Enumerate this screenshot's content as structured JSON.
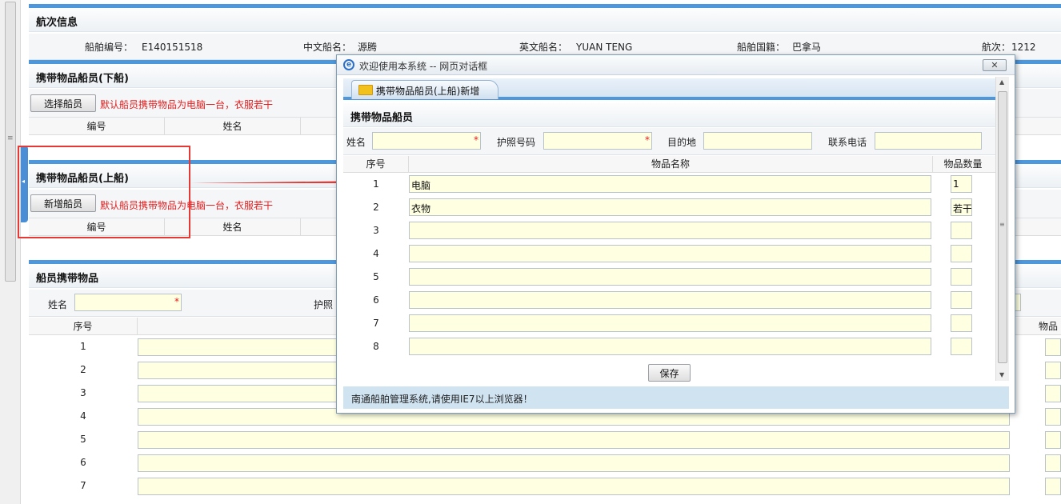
{
  "voyage_info": {
    "title": "航次信息",
    "ship_no_label": "船舶编号：",
    "ship_no": "E140151518",
    "cn_name_label": "中文船名：",
    "cn_name": "源腾",
    "en_name_label": "英文船名：",
    "en_name": "YUAN TENG",
    "nationality_label": "船舶国籍：",
    "nationality": "巴拿马",
    "voyage_label": "航次：",
    "voyage": "1212"
  },
  "disembark": {
    "title": "携带物品船员(下船)",
    "select_button": "选择船员",
    "note": "默认船员携带物品为电脑一台，衣服若干",
    "col_no": "编号",
    "col_name": "姓名"
  },
  "embark": {
    "title": "携带物品船员(上船)",
    "add_button": "新增船员",
    "note": "默认船员携带物品为电脑一台，衣服若干",
    "col_no": "编号",
    "col_name": "姓名"
  },
  "crew_items": {
    "title": "船员携带物品",
    "name_label": "姓名",
    "passport_label": "护照",
    "col_seq": "序号",
    "col_qty": "物品",
    "rows": [
      "1",
      "2",
      "3",
      "4",
      "5",
      "6",
      "7"
    ]
  },
  "dialog": {
    "window_title": "欢迎使用本系统 -- 网页对话框",
    "ie_icon_glyph": "e",
    "close_glyph": "✕",
    "tab_label": "携带物品船员(上船)新增",
    "section_title": "携带物品船员",
    "form": {
      "name_label": "姓名",
      "passport_label": "护照号码",
      "destination_label": "目的地",
      "phone_label": "联系电话",
      "required_mark": "*"
    },
    "table": {
      "col_seq": "序号",
      "col_item": "物品名称",
      "col_qty": "物品数量",
      "rows": [
        {
          "seq": "1",
          "item": "电脑",
          "qty": "1"
        },
        {
          "seq": "2",
          "item": "衣物",
          "qty": "若干"
        },
        {
          "seq": "3",
          "item": "",
          "qty": ""
        },
        {
          "seq": "4",
          "item": "",
          "qty": ""
        },
        {
          "seq": "5",
          "item": "",
          "qty": ""
        },
        {
          "seq": "6",
          "item": "",
          "qty": ""
        },
        {
          "seq": "7",
          "item": "",
          "qty": ""
        },
        {
          "seq": "8",
          "item": "",
          "qty": ""
        }
      ]
    },
    "save_button": "保存",
    "status": "南通船舶管理系统,请使用IE7以上浏览器！"
  },
  "colors": {
    "accent_bar": "#4d97dd",
    "input_bg": "#ffffe1",
    "note_red": "#e02020",
    "annotation_red": "#e53935"
  },
  "icons": {
    "collapse_arrow": "◂",
    "scroll_grip": "≡",
    "scroll_up": "▲",
    "scroll_down": "▼"
  }
}
